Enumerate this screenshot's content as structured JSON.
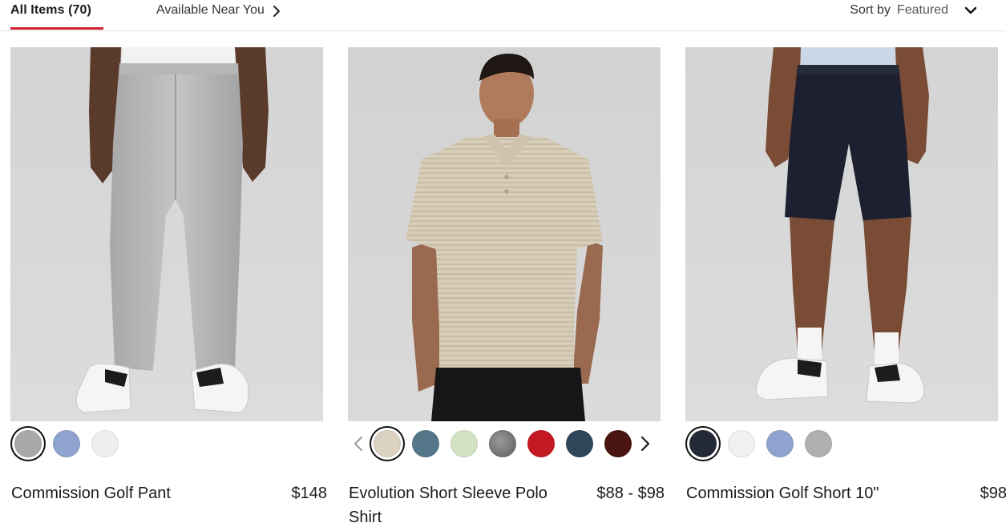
{
  "tabs": {
    "all_items": "All Items (70)",
    "available_near_you": "Available Near You"
  },
  "sort": {
    "label": "Sort by",
    "value": "Featured"
  },
  "colors": {
    "accent": "#d22030"
  },
  "products": [
    {
      "title": "Commission Golf Pant",
      "price": "$148",
      "swatches": [
        "#a9a9a9",
        "#8fa3cf",
        "#eeeeee"
      ],
      "selected_swatch": 0
    },
    {
      "title": "Evolution Short Sleeve Polo Shirt",
      "price": "$88 - $98",
      "swatches": [
        "#dcd2c1",
        "#54788a",
        "#d3e2c3",
        "#7a7a7a",
        "#c41822",
        "#2f4559",
        "#4a1411"
      ],
      "selected_swatch": 0
    },
    {
      "title": "Commission Golf Short 10\"",
      "price": "$98",
      "swatches": [
        "#242938",
        "#f0f0f0",
        "#8fa3cf",
        "#b0b0b0"
      ],
      "selected_swatch": 0
    }
  ]
}
